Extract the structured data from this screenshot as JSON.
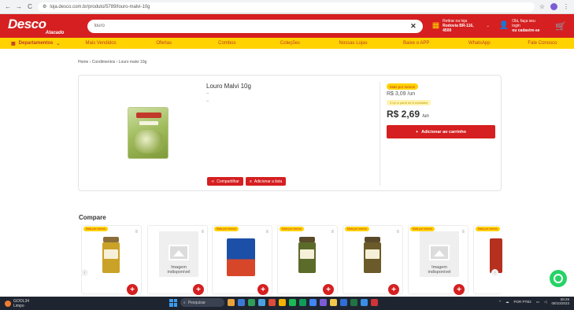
{
  "browser": {
    "url": "loja.desco.com.br/produto/5789/louro-malvi-10g",
    "back": "←",
    "forward": "→",
    "reload": "C"
  },
  "header": {
    "brand": "Desco",
    "brand_sub": "Atacado",
    "search_value": "louro",
    "store_label": "Retirar na loja",
    "store_value": "Rodovia BR-116, 4500",
    "login_label": "Olá, faça seu login",
    "login_sub": "ou cadastre-se"
  },
  "menu": {
    "departments": "Departamentos",
    "items": [
      "Mais Vendidos",
      "Ofertas",
      "Combos",
      "Coleções",
      "Nossas Lojas",
      "Baixe o APP",
      "WhatsApp",
      "Fale Conosco"
    ]
  },
  "breadcrumb": "Home › Condimentos › Louro malvi 10g",
  "product": {
    "title": "Louro Malvi 10g",
    "dash1": "–",
    "dash2": "–",
    "badge": "Mais por menos",
    "old_price": "R$ 3,09 /un",
    "tier": "3 Un a partir de 6 unidades",
    "new_price": "R$ 2,69",
    "unit": "/un",
    "add_to_cart": "Adicionar ao carrinho",
    "share": "Compartilhar",
    "add_list": "Adicionar a lista"
  },
  "compare": {
    "title": "Compare",
    "items": [
      {
        "tag": "Mais por menos",
        "kind": "jar",
        "color": "#c9a227"
      },
      {
        "tag": "",
        "kind": "placeholder",
        "text1": "Imagem",
        "text2": "indisponível"
      },
      {
        "tag": "Mais por menos",
        "kind": "bag",
        "color": "#1c4fa8"
      },
      {
        "tag": "Mais por menos",
        "kind": "jar",
        "color": "#5b6b2a"
      },
      {
        "tag": "Mais por menos",
        "kind": "jar",
        "color": "#6b5a2a"
      },
      {
        "tag": "Mais por menos",
        "kind": "placeholder",
        "text1": "Imagem",
        "text2": "indisponível"
      },
      {
        "tag": "Mais por menos",
        "kind": "jar",
        "color": "#b5301e"
      }
    ]
  },
  "taskbar": {
    "weather_temp": "GOOL34",
    "weather_desc": "Limpo",
    "search": "Pesquisar",
    "lang": "POR PTB2",
    "time": "08:29",
    "date": "08/10/2023"
  }
}
